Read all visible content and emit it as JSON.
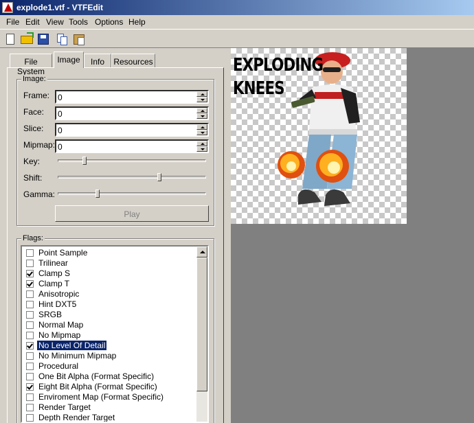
{
  "window": {
    "title": "explode1.vtf - VTFEdit"
  },
  "menu": [
    "File",
    "Edit",
    "View",
    "Tools",
    "Options",
    "Help"
  ],
  "toolbar": {
    "buttons": [
      {
        "icon": "new-document-icon"
      },
      {
        "icon": "open-folder-icon"
      },
      {
        "icon": "save-disk-icon"
      },
      {
        "icon": "copy-icon"
      },
      {
        "icon": "paste-icon"
      }
    ]
  },
  "tabs": [
    {
      "label": "File System",
      "active": false
    },
    {
      "label": "Image",
      "active": true
    },
    {
      "label": "Info",
      "active": false
    },
    {
      "label": "Resources",
      "active": false
    }
  ],
  "image_group": {
    "title": "Image:",
    "fields": [
      {
        "label": "Frame:",
        "value": "0"
      },
      {
        "label": "Face:",
        "value": "0"
      },
      {
        "label": "Slice:",
        "value": "0"
      },
      {
        "label": "Mipmap:",
        "value": "0"
      }
    ],
    "sliders": [
      {
        "label": "Key:",
        "level": 0.17
      },
      {
        "label": "Shift:",
        "level": 0.69
      },
      {
        "label": "Gamma:",
        "level": 0.26
      }
    ],
    "play_label": "Play"
  },
  "flags_group": {
    "title": "Flags:",
    "items": [
      {
        "label": "Point Sample",
        "checked": false,
        "selected": false
      },
      {
        "label": "Trilinear",
        "checked": false,
        "selected": false
      },
      {
        "label": "Clamp S",
        "checked": true,
        "selected": false
      },
      {
        "label": "Clamp T",
        "checked": true,
        "selected": false
      },
      {
        "label": "Anisotropic",
        "checked": false,
        "selected": false
      },
      {
        "label": "Hint DXT5",
        "checked": false,
        "selected": false
      },
      {
        "label": "SRGB",
        "checked": false,
        "selected": false
      },
      {
        "label": "Normal Map",
        "checked": false,
        "selected": false
      },
      {
        "label": "No Mipmap",
        "checked": false,
        "selected": false
      },
      {
        "label": "No Level Of Detail",
        "checked": true,
        "selected": true
      },
      {
        "label": "No Minimum Mipmap",
        "checked": false,
        "selected": false
      },
      {
        "label": "Procedural",
        "checked": false,
        "selected": false
      },
      {
        "label": "One Bit Alpha (Format Specific)",
        "checked": false,
        "selected": false
      },
      {
        "label": "Eight Bit Alpha (Format Specific)",
        "checked": true,
        "selected": false
      },
      {
        "label": "Enviroment Map (Format Specific)",
        "checked": false,
        "selected": false
      },
      {
        "label": "Render Target",
        "checked": false,
        "selected": false
      },
      {
        "label": "Depth Render Target",
        "checked": false,
        "selected": false
      }
    ]
  },
  "preview": {
    "caption_line1": "EXPLODING",
    "caption_line2": "KNEES",
    "colors": {
      "viewport_bg": "#808080",
      "selection": "#0a246a"
    }
  }
}
